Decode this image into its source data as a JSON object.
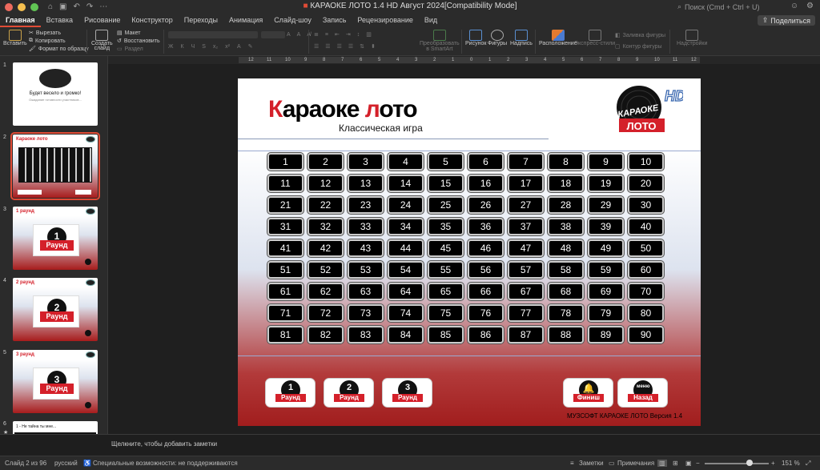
{
  "window": {
    "title": "КАРАОКЕ ЛОТО 1.4 HD Август 2024[Compatibility Mode]",
    "search_placeholder": "Поиск (Cmd + Ctrl + U)"
  },
  "tabs": [
    "Главная",
    "Вставка",
    "Рисование",
    "Конструктор",
    "Переходы",
    "Анимация",
    "Слайд-шоу",
    "Запись",
    "Рецензирование",
    "Вид"
  ],
  "share_label": "Поделиться",
  "ribbon": {
    "paste": "Вставить",
    "cut": "Вырезать",
    "copy": "Копировать",
    "format_painter": "Формат по образцу",
    "new_slide_1": "Создать",
    "new_slide_2": "слайд",
    "layout": "Макет",
    "reset": "Восстановить",
    "section": "Раздел",
    "smartart_1": "Преобразовать",
    "smartart_2": "в SmartArt",
    "picture": "Рисунок",
    "shapes": "Фигуры",
    "textbox": "Надпись",
    "arrange": "Расположение",
    "quick_styles": "Экспресс-стили",
    "shape_fill": "Заливка фигуры",
    "shape_outline": "Контур фигуры",
    "addins": "Надстройки"
  },
  "ruler_ticks": [
    "12",
    "11",
    "10",
    "9",
    "8",
    "7",
    "6",
    "5",
    "4",
    "3",
    "2",
    "1",
    "0",
    "1",
    "2",
    "3",
    "4",
    "5",
    "6",
    "7",
    "8",
    "9",
    "10",
    "11",
    "12"
  ],
  "thumbs": [
    {
      "num": "1",
      "title": "Будет весело и громко!",
      "sub": "Ожидание готовности участников..."
    },
    {
      "num": "2",
      "title": "Караоке лото"
    },
    {
      "num": "3",
      "title": "1 раунд",
      "digit": "1",
      "label": "Раунд"
    },
    {
      "num": "4",
      "title": "2 раунд",
      "digit": "2",
      "label": "Раунд"
    },
    {
      "num": "5",
      "title": "3 раунд",
      "digit": "3",
      "label": "Раунд"
    },
    {
      "num": "6",
      "title": "1 - Не тайна ты мне..."
    }
  ],
  "slide": {
    "title_first": "К",
    "title_rest": "араоке ",
    "title_l": "л",
    "title_end": "ото",
    "subtitle": "Классическая игра",
    "logo_hd": "HD",
    "logo_karaoke": "КАРАОКЕ",
    "logo_loto": "ЛОТО",
    "numbers": [
      "1",
      "2",
      "3",
      "4",
      "5",
      "6",
      "7",
      "8",
      "9",
      "10",
      "11",
      "12",
      "13",
      "14",
      "15",
      "16",
      "17",
      "18",
      "19",
      "20",
      "21",
      "22",
      "23",
      "24",
      "25",
      "26",
      "27",
      "28",
      "29",
      "30",
      "31",
      "32",
      "33",
      "34",
      "35",
      "36",
      "37",
      "38",
      "39",
      "40",
      "41",
      "42",
      "43",
      "44",
      "45",
      "46",
      "47",
      "48",
      "49",
      "50",
      "51",
      "52",
      "53",
      "54",
      "55",
      "56",
      "57",
      "58",
      "59",
      "60",
      "61",
      "62",
      "63",
      "64",
      "65",
      "66",
      "67",
      "68",
      "69",
      "70",
      "71",
      "72",
      "73",
      "74",
      "75",
      "76",
      "77",
      "78",
      "79",
      "80",
      "81",
      "82",
      "83",
      "84",
      "85",
      "86",
      "87",
      "88",
      "89",
      "90"
    ],
    "round_buttons": [
      {
        "digit": "1",
        "label": "Раунд"
      },
      {
        "digit": "2",
        "label": "Раунд"
      },
      {
        "digit": "3",
        "label": "Раунд"
      }
    ],
    "finish_label": "Финиш",
    "menu_top": "меню",
    "back_label": "Назад",
    "version": "МУЗСОФТ  КАРАОКЕ ЛОТО Версия 1.4"
  },
  "notes_placeholder": "Щелкните, чтобы добавить заметки",
  "status": {
    "slide": "Слайд 2 из 96",
    "language": "русский",
    "accessibility": "Специальные возможности: не поддерживаются",
    "notes": "Заметки",
    "comments": "Примечания",
    "zoom": "151 %"
  },
  "colors": {
    "accent": "#e04b36",
    "brand_red": "#d4202a"
  }
}
